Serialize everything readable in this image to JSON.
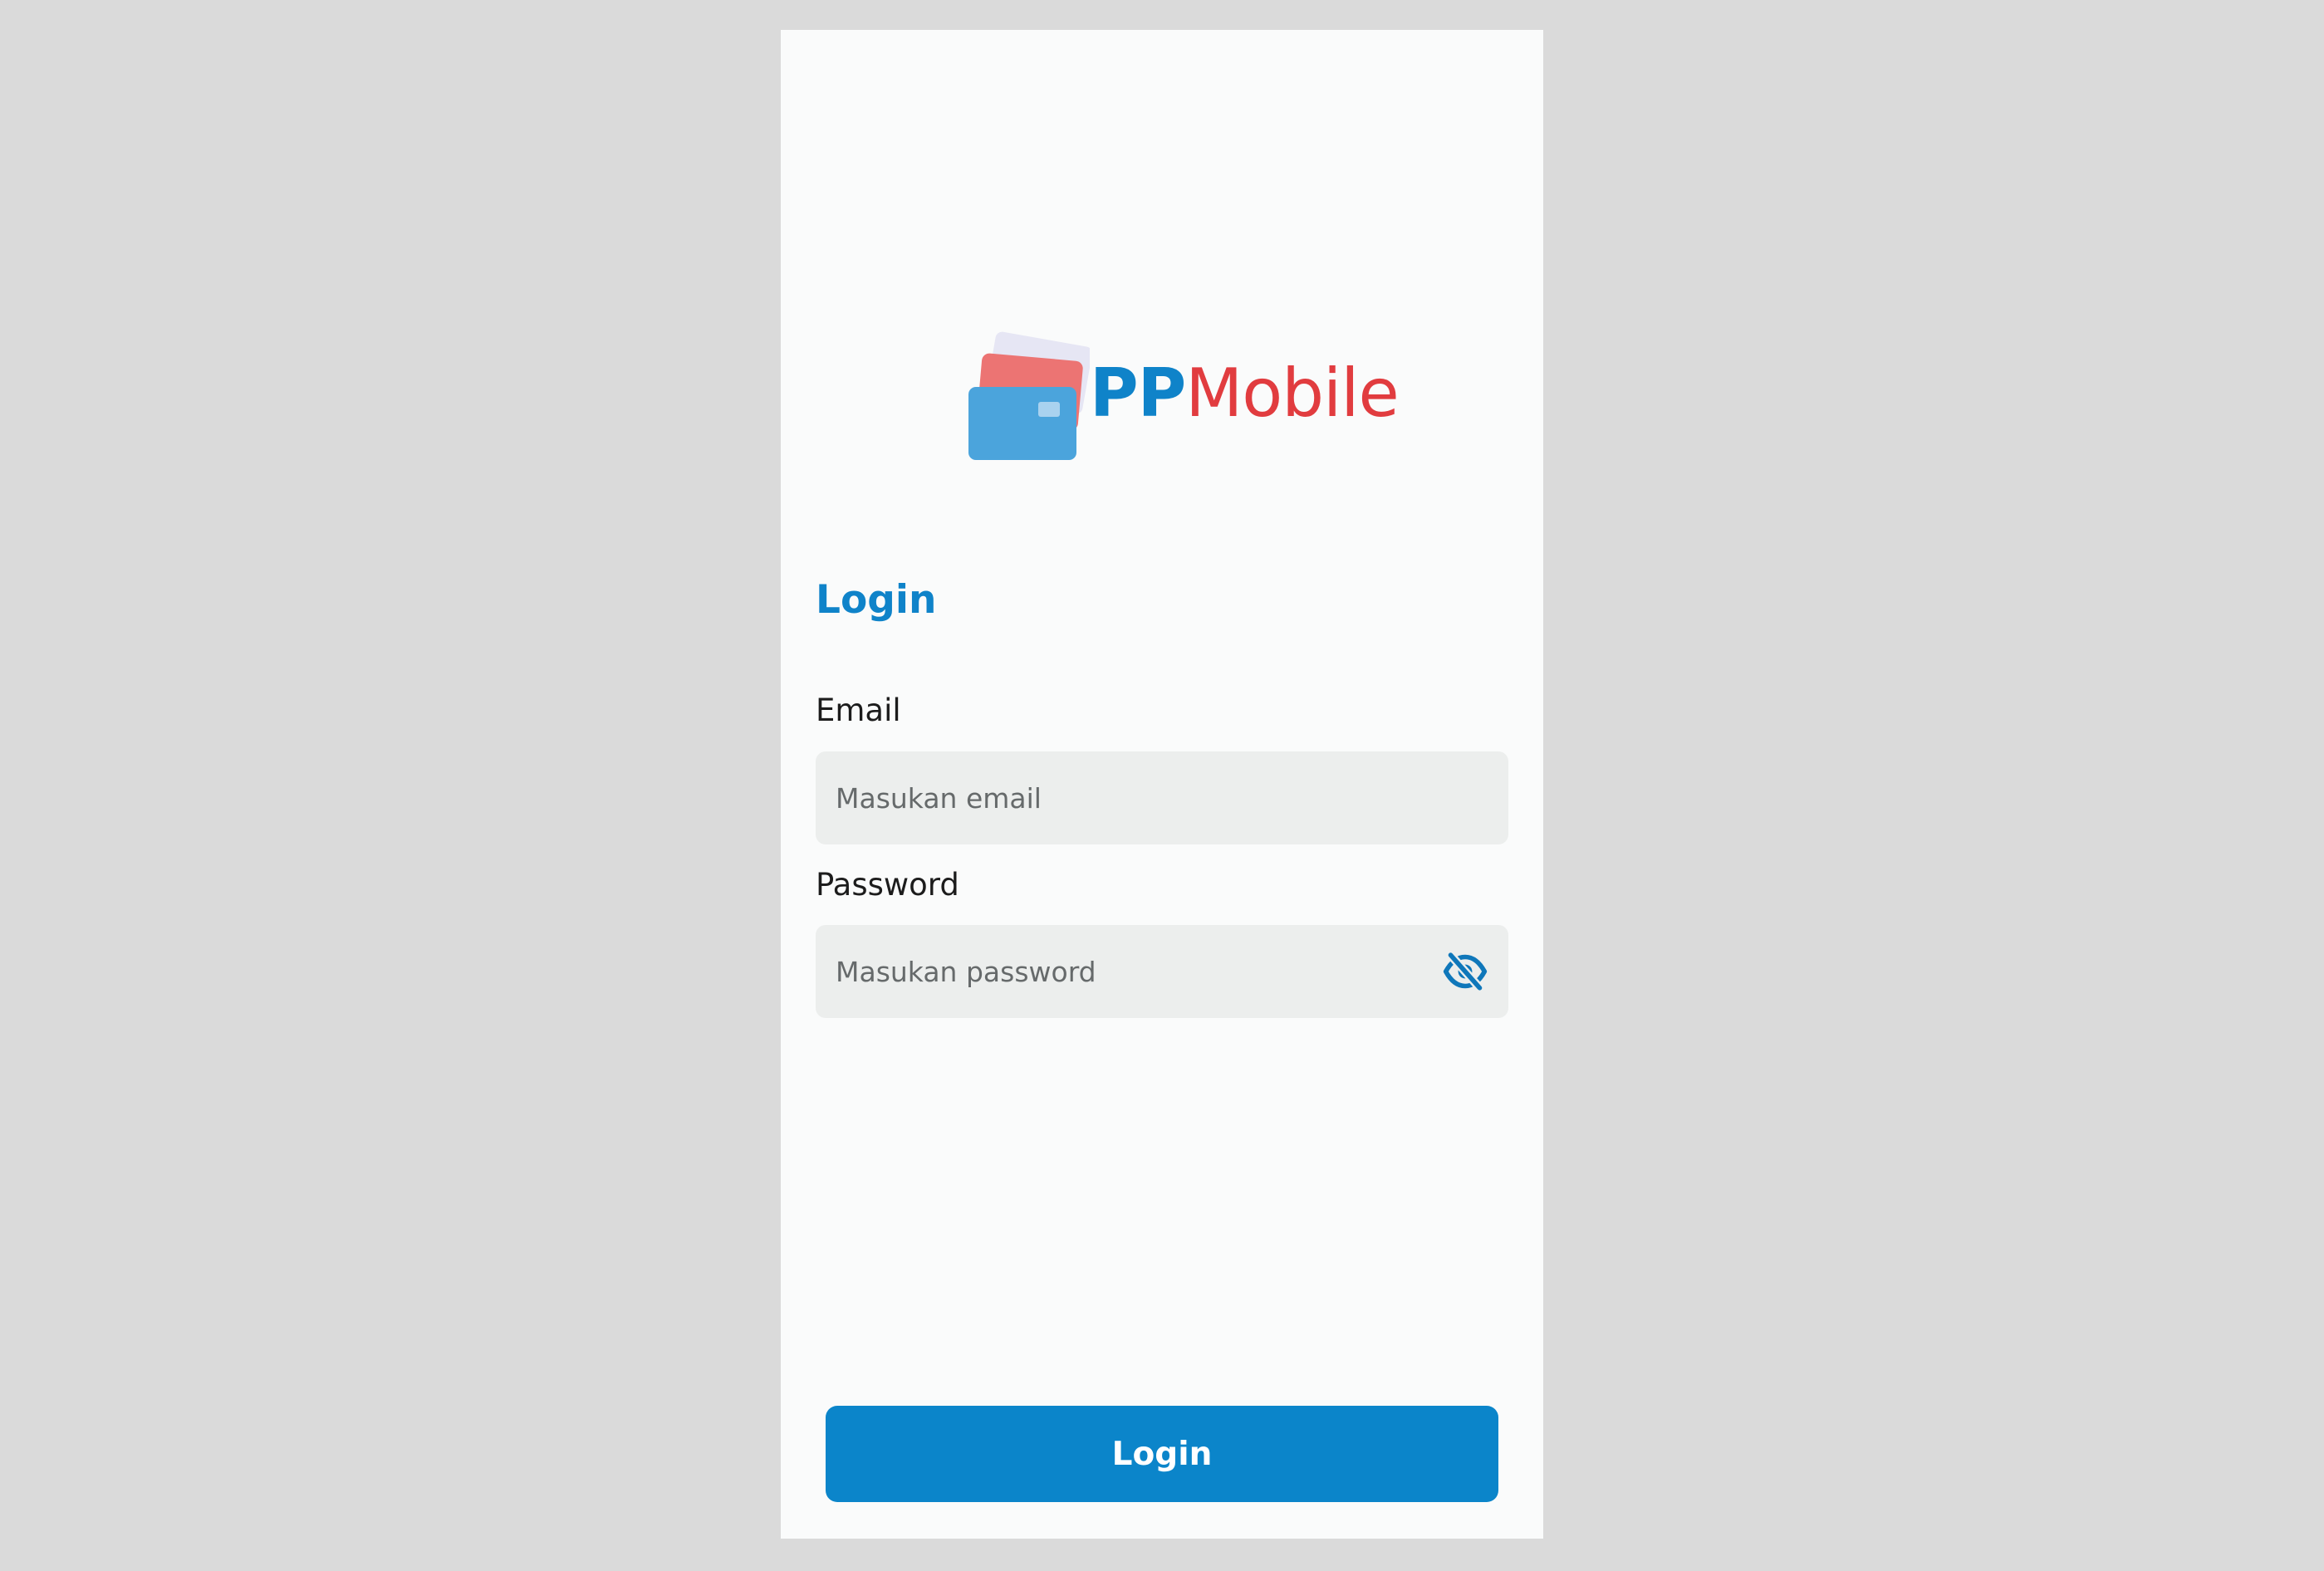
{
  "brand": {
    "name_part1": "PP",
    "name_part2": "Mobile",
    "logo_icon": "wallet-cards-icon",
    "colors": {
      "primary": "#0f83c9",
      "accent": "#e13c3f",
      "background": "#fafbfb",
      "field_bg": "#eceeed"
    }
  },
  "form": {
    "heading": "Login",
    "email": {
      "label": "Email",
      "placeholder": "Masukan email",
      "value": ""
    },
    "password": {
      "label": "Password",
      "placeholder": "Masukan password",
      "value": "",
      "toggle_icon": "eye-off-icon"
    },
    "submit_label": "Login"
  }
}
